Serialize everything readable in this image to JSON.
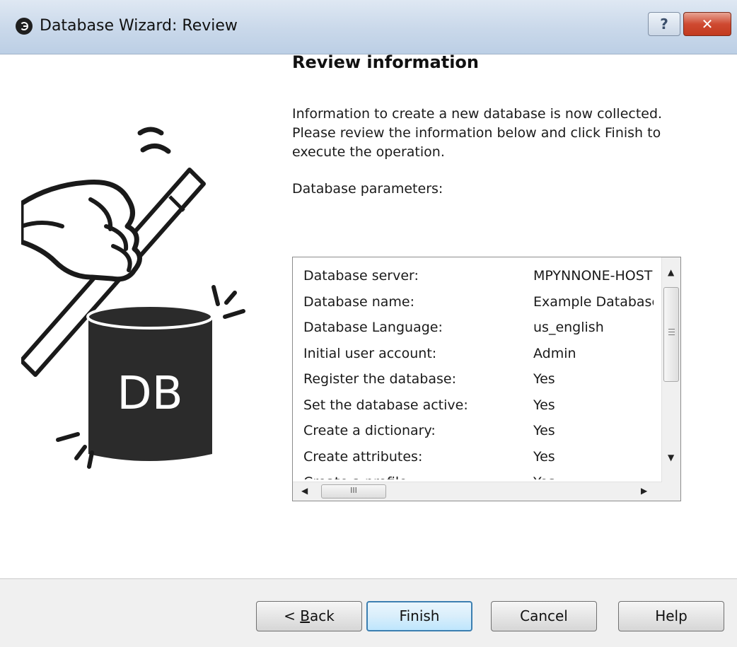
{
  "window": {
    "title": "Database Wizard: Review",
    "help_glyph": "?",
    "close_glyph": "✕"
  },
  "illustration": {
    "badge_text": "DB"
  },
  "content": {
    "heading": "Review information",
    "description": "Information to create a new database is now collected. Please review the information below and click Finish to execute the operation.",
    "params_label": "Database parameters:"
  },
  "parameters": [
    {
      "key": "Database server:",
      "value": "MPYNNONE-HOST"
    },
    {
      "key": "Database name:",
      "value": "Example Database"
    },
    {
      "key": "Database Language:",
      "value": "us_english"
    },
    {
      "key": "Initial user account:",
      "value": "Admin"
    },
    {
      "key": "Register the database:",
      "value": "Yes"
    },
    {
      "key": "Set the database active:",
      "value": "Yes"
    },
    {
      "key": "Create a dictionary:",
      "value": "Yes"
    },
    {
      "key": "Create attributes:",
      "value": "Yes"
    },
    {
      "key": "Create a profile:",
      "value": "Yes"
    }
  ],
  "scrollbar": {
    "hthumb_grip": "III"
  },
  "buttons": {
    "back_prefix": "< ",
    "back_access": "B",
    "back_rest": "ack",
    "finish": "Finish",
    "cancel": "Cancel",
    "help": "Help"
  }
}
